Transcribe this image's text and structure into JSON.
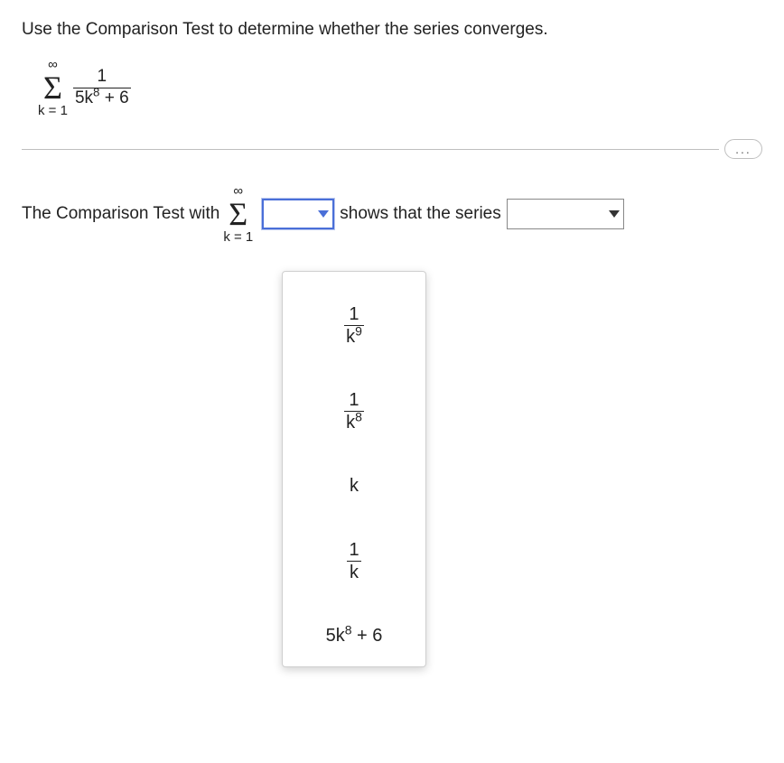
{
  "question": "Use the Comparison Test to determine whether the series converges.",
  "series": {
    "upper": "∞",
    "lower": "k = 1",
    "num": "1",
    "den_base": "5k",
    "den_exp": "8",
    "den_tail": " + 6"
  },
  "answer": {
    "pre": "The Comparison Test with ",
    "sigma_upper": "∞",
    "sigma_lower": "k = 1",
    "mid": " shows that the series "
  },
  "dropdown1": {
    "value": ""
  },
  "dropdown2": {
    "value": ""
  },
  "options": {
    "o1_num": "1",
    "o1_den_base": "k",
    "o1_den_exp": "9",
    "o2_num": "1",
    "o2_den_base": "k",
    "o2_den_exp": "8",
    "o3": "k",
    "o4_num": "1",
    "o4_den": "k",
    "o5_base": "5k",
    "o5_exp": "8",
    "o5_tail": " + 6"
  },
  "dots": "..."
}
